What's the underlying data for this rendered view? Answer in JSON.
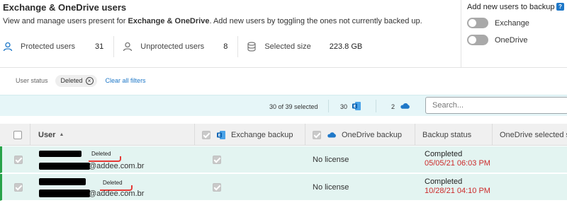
{
  "page": {
    "title": "Exchange & OneDrive users",
    "subtitle_pre": "View and manage users present for ",
    "subtitle_bold": "Exchange & OneDrive",
    "subtitle_post": ". Add new users by toggling the ones not currently backed up."
  },
  "stats": [
    {
      "icon": "person-icon",
      "label": "Protected users",
      "value": "31"
    },
    {
      "icon": "person-outline-icon",
      "label": "Unprotected users",
      "value": "8"
    },
    {
      "icon": "database-icon",
      "label": "Selected size",
      "value": "223.8 GB"
    }
  ],
  "add_users": {
    "title": "Add new users to backup",
    "help": "?",
    "toggles": [
      {
        "label": "Exchange",
        "on": false
      },
      {
        "label": "OneDrive",
        "on": false
      }
    ]
  },
  "filters": {
    "label": "User status",
    "chip": "Deleted",
    "clear": "Clear all filters"
  },
  "selection_bar": {
    "selected": "30 of 39 selected",
    "exchange_count": "30",
    "onedrive_count": "2",
    "search_placeholder": "Search..."
  },
  "table": {
    "columns": {
      "user": "User",
      "exchange": "Exchange backup",
      "onedrive": "OneDrive backup",
      "status": "Backup status",
      "od_selected": "OneDrive selected s"
    },
    "rows": [
      {
        "badge": "Deleted",
        "email": "@addee.com.br",
        "onedrive": "No license",
        "status": "Completed",
        "date": "05/05/21 06:03 PM"
      },
      {
        "badge": "Deleted",
        "email": "@addee.com.br",
        "onedrive": "No license",
        "status": "Completed",
        "date": "10/28/21 04:10 PM"
      }
    ]
  },
  "colors": {
    "accent": "#1f78c8",
    "row_highlight": "#e3f4f1",
    "row_border": "#28a34a",
    "date_red": "#cc2a2a"
  }
}
